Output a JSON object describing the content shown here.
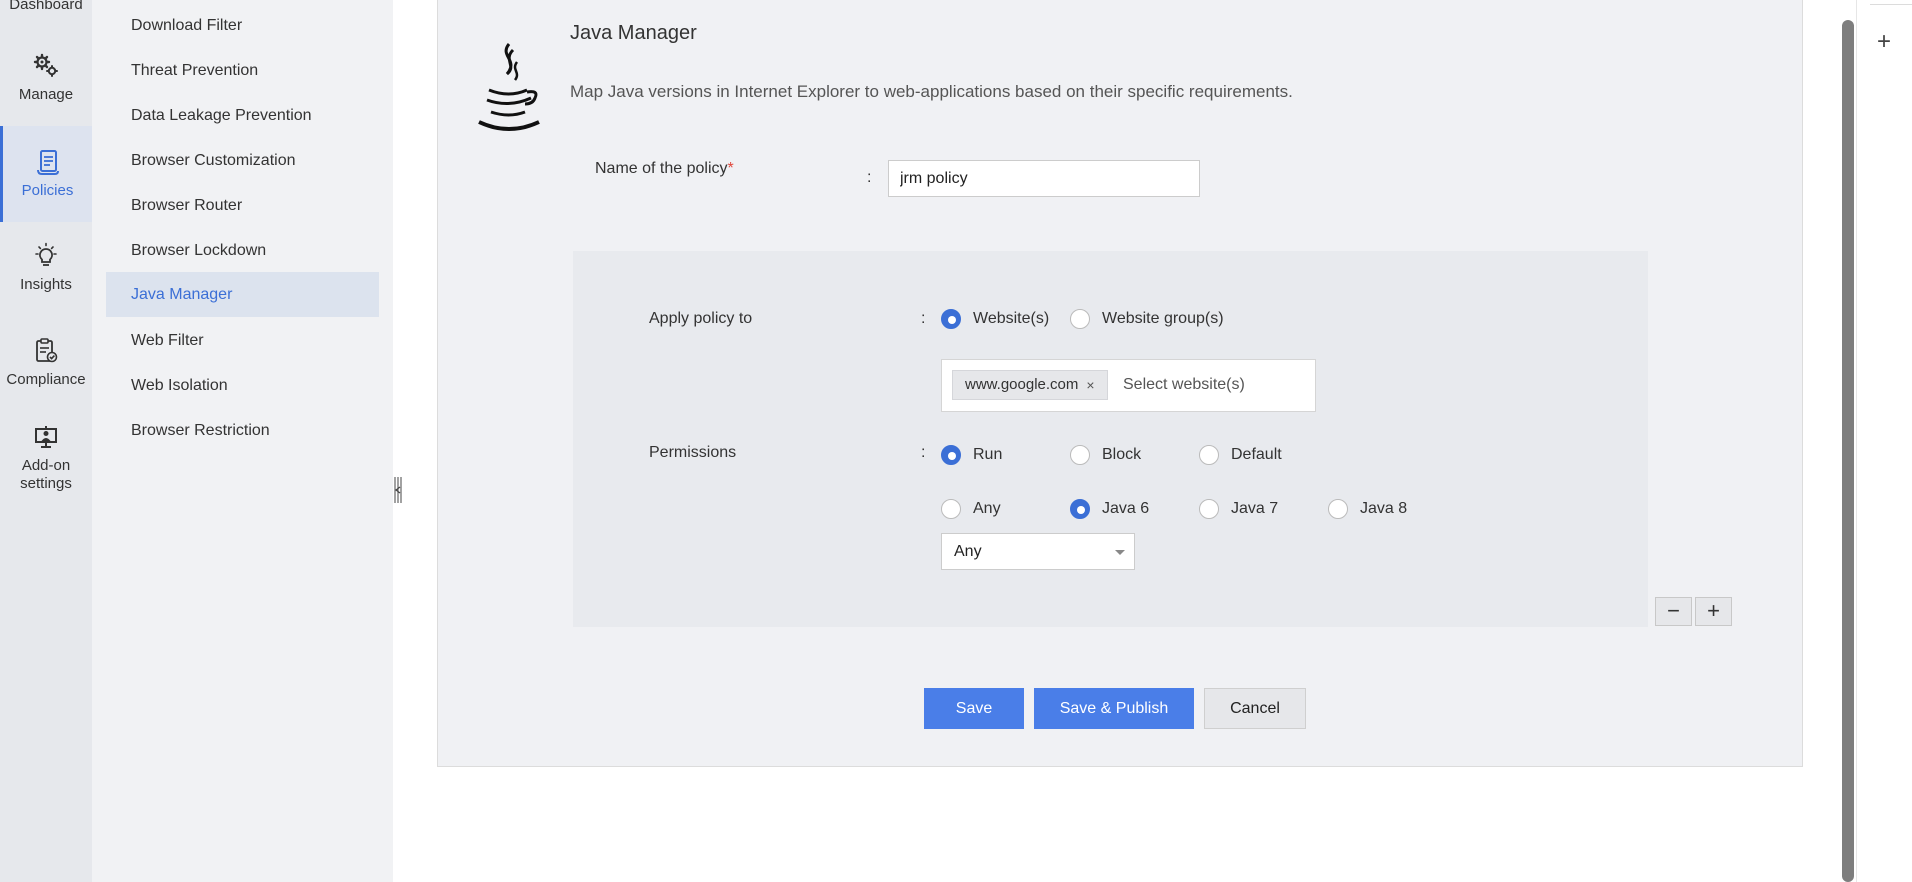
{
  "rail": {
    "dashboard": "Dashboard",
    "manage": "Manage",
    "policies": "Policies",
    "insights": "Insights",
    "compliance": "Compliance",
    "addon_line1": "Add-on",
    "addon_line2": "settings"
  },
  "subnav": {
    "items": [
      {
        "label": "Download Filter"
      },
      {
        "label": "Threat Prevention"
      },
      {
        "label": "Data Leakage Prevention"
      },
      {
        "label": "Browser Customization"
      },
      {
        "label": "Browser Router"
      },
      {
        "label": "Browser Lockdown"
      },
      {
        "label": "Java Manager",
        "active": true
      },
      {
        "label": "Web Filter"
      },
      {
        "label": "Web Isolation"
      },
      {
        "label": "Browser Restriction"
      }
    ]
  },
  "page": {
    "title": "Java Manager",
    "description": "Map Java versions in Internet Explorer to web-applications based on their specific requirements."
  },
  "form": {
    "name_label": "Name of the policy",
    "required_mark": "*",
    "colon": ":",
    "name_value": "jrm policy",
    "apply_label": "Apply policy to",
    "apply_options": {
      "websites": "Website(s)",
      "groups": "Website group(s)"
    },
    "apply_selected": "websites",
    "tag_value": "www.google.com",
    "tag_remove": "×",
    "tag_placeholder": "Select website(s)",
    "permissions_label": "Permissions",
    "permission_options": {
      "run": "Run",
      "block": "Block",
      "default": "Default"
    },
    "permission_selected": "run",
    "java_options": {
      "any": "Any",
      "java6": "Java 6",
      "java7": "Java 7",
      "java8": "Java 8"
    },
    "java_selected": "java6",
    "version_select": "Any",
    "minus": "−",
    "plus": "+"
  },
  "actions": {
    "save": "Save",
    "save_publish": "Save & Publish",
    "cancel": "Cancel"
  },
  "colors": {
    "accent": "#3b6fd6",
    "primary_button": "#4a7ee8",
    "required": "#e0453a"
  },
  "icons": {
    "manage": "gears-icon",
    "policies": "policy-scroll-icon",
    "insights": "lightbulb-icon",
    "compliance": "clipboard-check-icon",
    "addon": "monitor-user-icon",
    "java": "java-cup-icon"
  }
}
